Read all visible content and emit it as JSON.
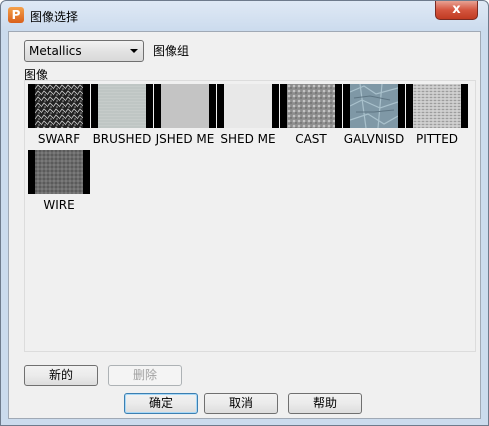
{
  "window": {
    "title": "图像选择",
    "app_icon_letter": "P",
    "close_label": "x"
  },
  "group_select": {
    "selected": "Metallics",
    "label": "图像组"
  },
  "images_label": "图像",
  "thumbnails": [
    {
      "label": "SWARF",
      "texture": "swarf"
    },
    {
      "label": "BRUSHED",
      "texture": "brushed"
    },
    {
      "label": "JSHED ME",
      "texture": "polished"
    },
    {
      "label": "SHED ME",
      "texture": "polished2"
    },
    {
      "label": "CAST",
      "texture": "cast"
    },
    {
      "label": "GALVNISD",
      "texture": "galv"
    },
    {
      "label": "PITTED",
      "texture": "pitted"
    },
    {
      "label": "WIRE",
      "texture": "wire"
    }
  ],
  "buttons": {
    "new": "新的",
    "delete": "删除",
    "ok": "确定",
    "cancel": "取消",
    "help": "帮助"
  }
}
